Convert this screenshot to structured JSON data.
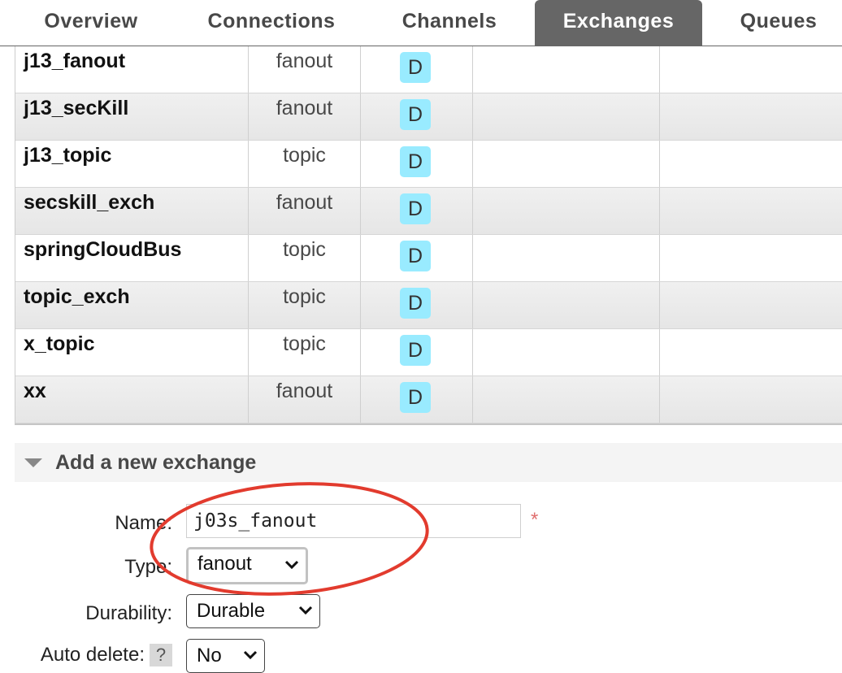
{
  "tabs": [
    {
      "label": "Overview",
      "active": false
    },
    {
      "label": "Connections",
      "active": false
    },
    {
      "label": "Channels",
      "active": false
    },
    {
      "label": "Exchanges",
      "active": true
    },
    {
      "label": "Queues",
      "active": false
    }
  ],
  "exchanges": [
    {
      "name": "j13_fanout",
      "type": "fanout",
      "feature": "D"
    },
    {
      "name": "j13_secKill",
      "type": "fanout",
      "feature": "D"
    },
    {
      "name": "j13_topic",
      "type": "topic",
      "feature": "D"
    },
    {
      "name": "secskill_exch",
      "type": "fanout",
      "feature": "D"
    },
    {
      "name": "springCloudBus",
      "type": "topic",
      "feature": "D"
    },
    {
      "name": "topic_exch",
      "type": "topic",
      "feature": "D"
    },
    {
      "name": "x_topic",
      "type": "topic",
      "feature": "D"
    },
    {
      "name": "xx",
      "type": "fanout",
      "feature": "D"
    }
  ],
  "add_exchange": {
    "title": "Add a new exchange",
    "name_label": "Name:",
    "name_value": "j03s_fanout",
    "required_mark": "*",
    "type_label": "Type:",
    "type_value": "fanout",
    "durability_label": "Durability:",
    "durability_value": "Durable",
    "auto_delete_label": "Auto delete:",
    "auto_delete_help": "?",
    "auto_delete_value": "No"
  },
  "colors": {
    "active_tab": "#666666",
    "badge": "#99ebff",
    "annotation": "#e23b2e",
    "required": "#e06f6f"
  }
}
